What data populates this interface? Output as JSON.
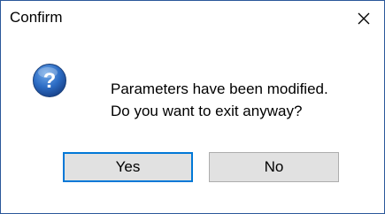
{
  "window": {
    "title": "Confirm",
    "close_icon": "close-icon"
  },
  "dialog": {
    "icon": "question-icon",
    "message_line1": "Parameters have been modified.",
    "message_line2": "Do you want to exit anyway?"
  },
  "buttons": {
    "yes_label": "Yes",
    "no_label": "No"
  },
  "colors": {
    "border": "#2b579a",
    "button_face": "#e1e1e1",
    "button_border": "#adadad",
    "focus_accent": "#0078d7",
    "icon_blue": "#1e5aa8"
  }
}
